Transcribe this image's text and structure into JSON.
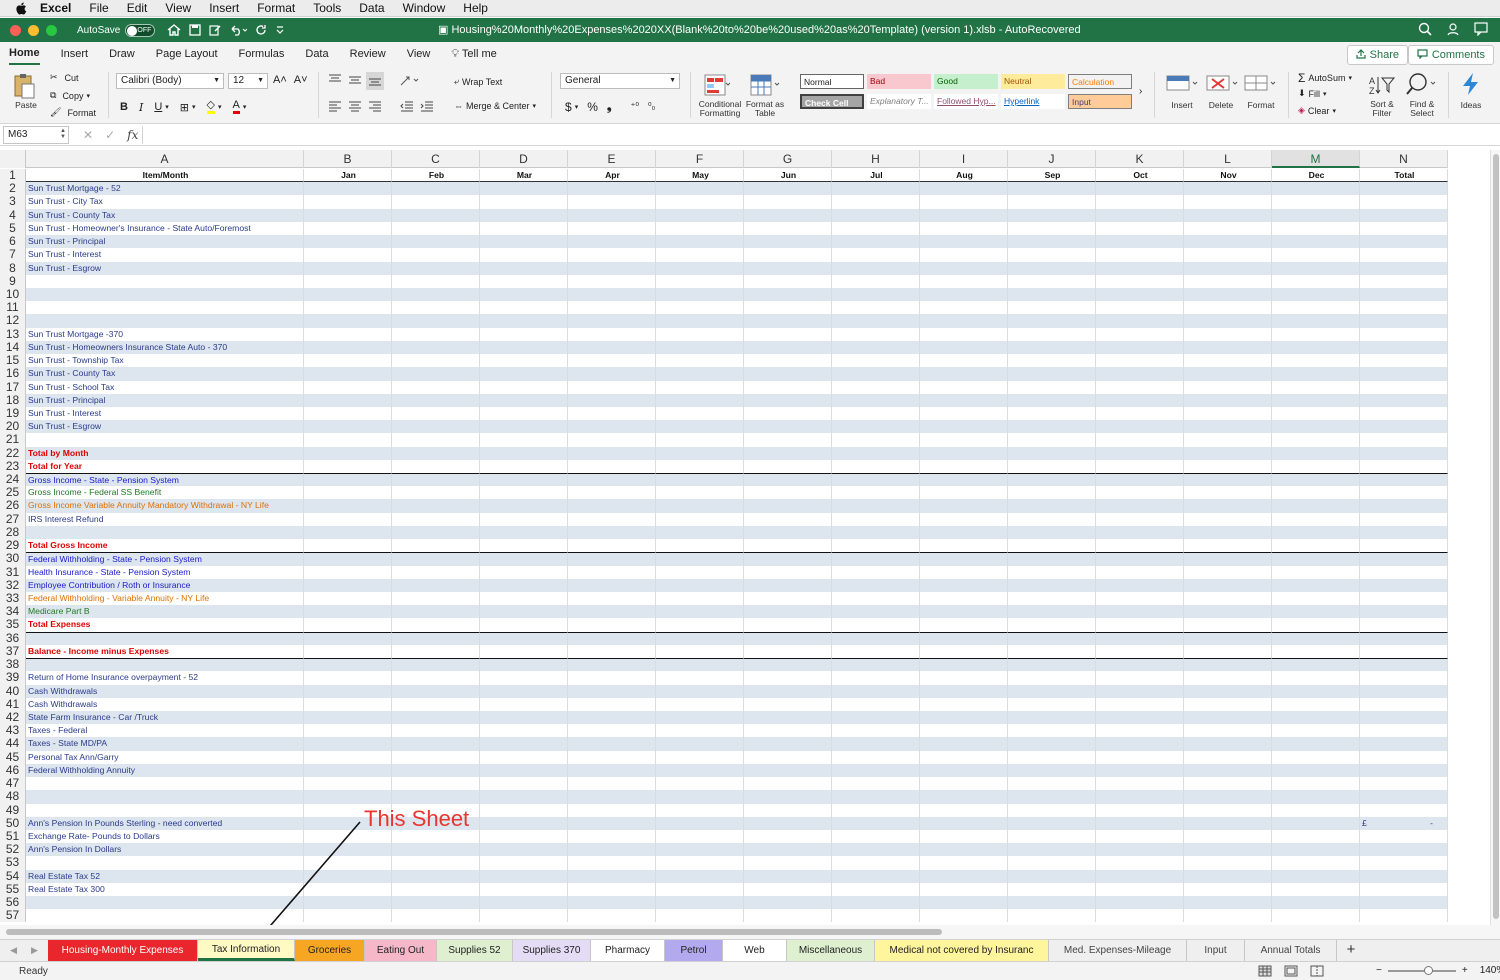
{
  "menubar": {
    "app": "Excel",
    "items": [
      "File",
      "Edit",
      "View",
      "Insert",
      "Format",
      "Tools",
      "Data",
      "Window",
      "Help"
    ]
  },
  "titlebar": {
    "autosave_label": "AutoSave",
    "autosave_state": "OFF",
    "document_title": "Housing%20Monthly%20Expenses%2020XX(Blank%20to%20be%20used%20as%20Template) (version 1).xlsb  -  AutoRecovered"
  },
  "ribbon_tabs": [
    "Home",
    "Insert",
    "Draw",
    "Page Layout",
    "Formulas",
    "Data",
    "Review",
    "View"
  ],
  "tell_me": "Tell me",
  "share_label": "Share",
  "comments_label": "Comments",
  "ribbon": {
    "paste": "Paste",
    "cut": "Cut",
    "copy": "Copy",
    "format_painter": "Format",
    "font_name": "Calibri (Body)",
    "font_size": "12",
    "wrap_text": "Wrap Text",
    "merge_center": "Merge & Center",
    "number_format": "General",
    "conditional_formatting": "Conditional Formatting",
    "format_as_table": "Format as Table",
    "styles": [
      {
        "label": "Normal",
        "bg": "#ffffff",
        "fg": "#222222"
      },
      {
        "label": "Bad",
        "bg": "#f9c7ce",
        "fg": "#9c0006"
      },
      {
        "label": "Good",
        "bg": "#c6efce",
        "fg": "#006100"
      },
      {
        "label": "Neutral",
        "bg": "#ffeb9c",
        "fg": "#9c5700"
      },
      {
        "label": "Calculation",
        "bg": "#f2f2f2",
        "fg": "#fa7d00"
      },
      {
        "label": "Check Cell",
        "bg": "#a5a5a5",
        "fg": "#ffffff"
      },
      {
        "label": "Explanatory T...",
        "bg": "#ffffff",
        "fg": "#7f7f7f"
      },
      {
        "label": "Followed Hyp...",
        "bg": "#ffffff",
        "fg": "#954f72"
      },
      {
        "label": "Hyperlink",
        "bg": "#ffffff",
        "fg": "#0563c1"
      },
      {
        "label": "Input",
        "bg": "#ffcc99",
        "fg": "#3f3f76"
      }
    ],
    "insert": "Insert",
    "delete": "Delete",
    "format": "Format",
    "autosum": "AutoSum",
    "fill": "Fill",
    "clear": "Clear",
    "sort_filter": "Sort & Filter",
    "find_select": "Find & Select",
    "ideas": "Ideas"
  },
  "formula_bar": {
    "name_box": "M63",
    "fx": "fx",
    "formula": ""
  },
  "columns": {
    "letters": [
      "A",
      "B",
      "C",
      "D",
      "E",
      "F",
      "G",
      "H",
      "I",
      "J",
      "K",
      "L",
      "M",
      "N"
    ],
    "selected": "M",
    "header_row": [
      "Item/Month",
      "Jan",
      "Feb",
      "Mar",
      "Apr",
      "May",
      "Jun",
      "Jul",
      "Aug",
      "Sep",
      "Oct",
      "Nov",
      "Dec",
      "Total"
    ]
  },
  "rows": [
    {
      "n": "2",
      "a": "Sun Trust Mortgage - 52",
      "color": "navy"
    },
    {
      "n": "3",
      "a": "Sun Trust - City Tax",
      "color": "navy"
    },
    {
      "n": "4",
      "a": "Sun Trust - County Tax",
      "color": "navy"
    },
    {
      "n": "5",
      "a": "Sun Trust - Homeowner's Insurance - State Auto/Foremost",
      "color": "navy"
    },
    {
      "n": "6",
      "a": "Sun Trust - Principal",
      "color": "navy"
    },
    {
      "n": "7",
      "a": "Sun Trust - Interest",
      "color": "navy"
    },
    {
      "n": "8",
      "a": "Sun Trust - Esgrow",
      "color": "navy"
    },
    {
      "n": "9",
      "a": "",
      "color": "navy"
    },
    {
      "n": "10",
      "a": "",
      "color": "navy"
    },
    {
      "n": "11",
      "a": "",
      "color": "navy"
    },
    {
      "n": "12",
      "a": "",
      "color": "navy"
    },
    {
      "n": "13",
      "a": "Sun Trust Mortgage -370",
      "color": "navy"
    },
    {
      "n": "14",
      "a": "Sun Trust - Homeowners Insurance State Auto - 370",
      "color": "navy"
    },
    {
      "n": "15",
      "a": "Sun Trust - Township Tax",
      "color": "navy"
    },
    {
      "n": "16",
      "a": "Sun Trust - County Tax",
      "color": "navy"
    },
    {
      "n": "17",
      "a": "Sun Trust - School Tax",
      "color": "navy"
    },
    {
      "n": "18",
      "a": "Sun Trust - Principal",
      "color": "navy"
    },
    {
      "n": "19",
      "a": "Sun Trust - Interest",
      "color": "navy"
    },
    {
      "n": "20",
      "a": "Sun Trust - Esgrow",
      "color": "navy"
    },
    {
      "n": "21",
      "a": "",
      "color": "navy"
    },
    {
      "n": "22",
      "a": "Total by Month",
      "color": "red"
    },
    {
      "n": "23",
      "a": "Total for Year",
      "color": "red"
    },
    {
      "n": "24",
      "a": "Gross Income - State - Pension System",
      "color": "bblue",
      "topline": true
    },
    {
      "n": "25",
      "a": "Gross Income - Federal  SS Benefit",
      "color": "green"
    },
    {
      "n": "26",
      "a": "Gross Income Variable Annuity Mandatory Withdrawal - NY Life",
      "color": "orange"
    },
    {
      "n": "27",
      "a": "IRS Interest Refund",
      "color": "navy"
    },
    {
      "n": "28",
      "a": "",
      "color": "navy"
    },
    {
      "n": "29",
      "a": "Total Gross Income",
      "color": "red"
    },
    {
      "n": "30",
      "a": "Federal Withholding - State - Pension System",
      "color": "bblue",
      "topline": true
    },
    {
      "n": "31",
      "a": "Health Insurance - State - Pension System",
      "color": "bblue"
    },
    {
      "n": "32",
      "a": "Employee Contribution / Roth or Insurance",
      "color": "bblue"
    },
    {
      "n": "33",
      "a": "Federal Withholding - Variable Annuity - NY Life",
      "color": "orange"
    },
    {
      "n": "34",
      "a": "Medicare Part B",
      "color": "green"
    },
    {
      "n": "35",
      "a": "Total Expenses",
      "color": "red"
    },
    {
      "n": "36",
      "a": "",
      "color": "navy",
      "topline": true
    },
    {
      "n": "37",
      "a": "Balance - Income minus Expenses",
      "color": "red"
    },
    {
      "n": "38",
      "a": "",
      "color": "navy",
      "topline": true
    },
    {
      "n": "39",
      "a": "Return of Home Insurance overpayment - 52",
      "color": "navy"
    },
    {
      "n": "40",
      "a": "Cash Withdrawals",
      "color": "navy"
    },
    {
      "n": "41",
      "a": "Cash Withdrawals",
      "color": "navy"
    },
    {
      "n": "42",
      "a": "State Farm Insurance - Car /Truck",
      "color": "navy"
    },
    {
      "n": "43",
      "a": "Taxes - Federal",
      "color": "navy"
    },
    {
      "n": "44",
      "a": "Taxes - State MD/PA",
      "color": "navy"
    },
    {
      "n": "45",
      "a": "Personal Tax  Ann/Garry",
      "color": "navy"
    },
    {
      "n": "46",
      "a": "Federal Withholding Annuity",
      "color": "navy"
    },
    {
      "n": "47",
      "a": "",
      "color": "navy"
    },
    {
      "n": "48",
      "a": "",
      "color": "navy"
    },
    {
      "n": "49",
      "a": "",
      "color": "navy"
    },
    {
      "n": "50",
      "a": "Ann's Pension    In Pounds Sterling - need converted",
      "color": "navy",
      "n_left": "£",
      "n_right": "-"
    },
    {
      "n": "51",
      "a": "Exchange Rate-  Pounds to Dollars",
      "color": "navy"
    },
    {
      "n": "52",
      "a": "Ann's Pension  In Dollars",
      "color": "navy"
    },
    {
      "n": "53",
      "a": "",
      "color": "navy"
    },
    {
      "n": "54",
      "a": "Real Estate Tax 52",
      "color": "navy"
    },
    {
      "n": "55",
      "a": "Real Estate Tax 300",
      "color": "navy"
    },
    {
      "n": "56",
      "a": "",
      "color": "navy"
    },
    {
      "n": "57",
      "a": "",
      "color": "navy"
    }
  ],
  "annotation": "This Sheet",
  "sheet_tabs": [
    {
      "label": "Housing-Monthly Expenses",
      "bg": "#e8262b",
      "fg": "#ffffff"
    },
    {
      "label": "Tax Information",
      "bg": "#fff9c4",
      "fg": "#222222",
      "active": true
    },
    {
      "label": "Groceries",
      "bg": "#f6a623",
      "fg": "#222222"
    },
    {
      "label": "Eating Out",
      "bg": "#f6b8c8",
      "fg": "#222222"
    },
    {
      "label": "Supplies 52",
      "bg": "#dff0d0",
      "fg": "#222222"
    },
    {
      "label": "Supplies 370",
      "bg": "#e4dcf5",
      "fg": "#222222"
    },
    {
      "label": "Pharmacy",
      "bg": "#ffffff",
      "fg": "#222222"
    },
    {
      "label": "Petrol",
      "bg": "#b3a9ee",
      "fg": "#222222"
    },
    {
      "label": "Web",
      "bg": "#ffffff",
      "fg": "#222222"
    },
    {
      "label": "Miscellaneous",
      "bg": "#dff0d0",
      "fg": "#222222"
    },
    {
      "label": "Medical not covered by Insuranc",
      "bg": "#fff59d",
      "fg": "#222222"
    },
    {
      "label": "Med. Expenses-Mileage",
      "bg": "#efefef",
      "fg": "#444444"
    },
    {
      "label": "Input",
      "bg": "#efefef",
      "fg": "#444444"
    },
    {
      "label": "Annual Totals",
      "bg": "#efefef",
      "fg": "#444444"
    }
  ],
  "status": {
    "ready": "Ready",
    "zoom": "140%"
  }
}
